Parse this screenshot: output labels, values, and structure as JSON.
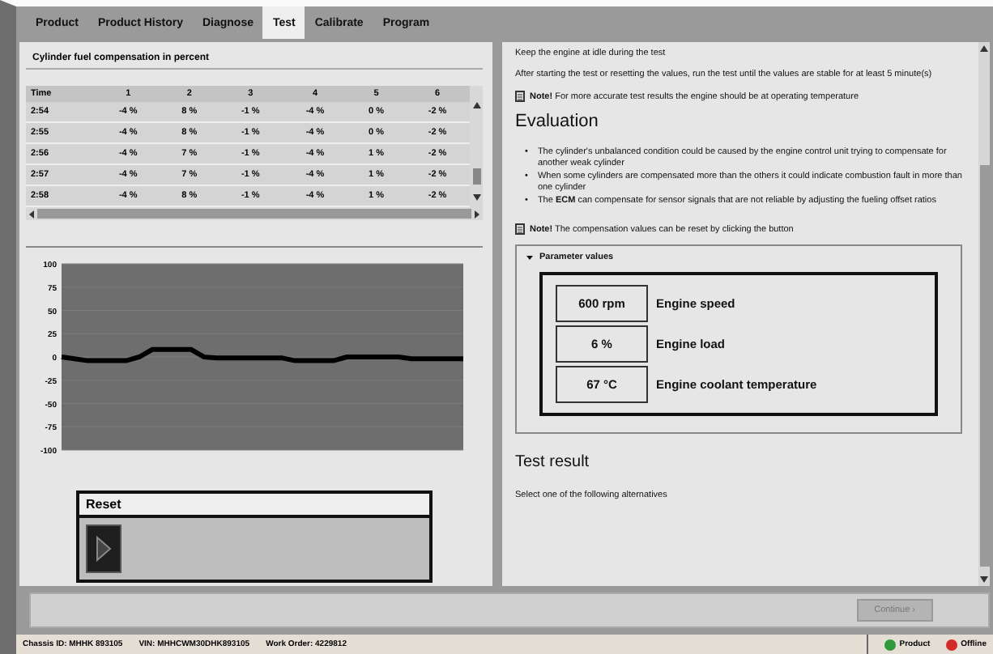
{
  "tabs": [
    {
      "label": "Product",
      "selected": false
    },
    {
      "label": "Product History",
      "selected": false
    },
    {
      "label": "Diagnose",
      "selected": false
    },
    {
      "label": "Test",
      "selected": true
    },
    {
      "label": "Calibrate",
      "selected": false
    },
    {
      "label": "Program",
      "selected": false
    }
  ],
  "left_panel": {
    "title": "Cylinder fuel compensation in percent",
    "table": {
      "columns": [
        "Time",
        "1",
        "2",
        "3",
        "4",
        "5",
        "6"
      ],
      "rows": [
        [
          "2:54",
          "-4 %",
          "8 %",
          "-1 %",
          "-4 %",
          "0 %",
          "-2 %"
        ],
        [
          "2:55",
          "-4 %",
          "8 %",
          "-1 %",
          "-4 %",
          "0 %",
          "-2 %"
        ],
        [
          "2:56",
          "-4 %",
          "7 %",
          "-1 %",
          "-4 %",
          "1 %",
          "-2 %"
        ],
        [
          "2:57",
          "-4 %",
          "7 %",
          "-1 %",
          "-4 %",
          "1 %",
          "-2 %"
        ],
        [
          "2:58",
          "-4 %",
          "8 %",
          "-1 %",
          "-4 %",
          "1 %",
          "-2 %"
        ]
      ]
    },
    "chart_data": {
      "type": "line",
      "grid": true,
      "ylim": [
        -100,
        100
      ],
      "yticks": [
        100,
        75,
        50,
        25,
        0,
        -25,
        -50,
        -75,
        -100
      ],
      "series": [
        {
          "color": "#000000",
          "values": [
            0,
            -2,
            -4,
            -4,
            -4,
            -4,
            0,
            8,
            8,
            8,
            8,
            0,
            -1,
            -1,
            -1,
            -1,
            -1,
            -1,
            -4,
            -4,
            -4,
            -4,
            0,
            0,
            0,
            0,
            0,
            -2,
            -2,
            -2,
            -2,
            -2
          ]
        }
      ]
    },
    "reset": {
      "title": "Reset"
    }
  },
  "right_panel": {
    "intro": [
      "Keep the engine at idle during the test",
      "After starting the test or resetting the values, run the test until the values are stable for at least 5 minute(s)"
    ],
    "note_1": "**Note!** For more accurate test results the engine should be at operating temperature",
    "heading": "Evaluation",
    "bullets": [
      {
        "marker": "•",
        "text": "The cylinder's unbalanced condition could be caused by the engine control unit trying to compensate for another weak cylinder"
      },
      {
        "marker": "•",
        "text": "When some cylinders are compensated more than the others it could indicate combustion fault in more than one cylinder"
      },
      {
        "marker": "•",
        "text": "The **ECM** can compensate for sensor signals that are not reliable by adjusting the fueling offset ratios"
      }
    ],
    "note_2": "**Note!** The compensation values can be reset by clicking the button",
    "parameters": {
      "title": "Parameter values",
      "expanded": true,
      "items": [
        {
          "value": "600 rpm",
          "label": "Engine speed"
        },
        {
          "value": "6 %",
          "label": "Engine load"
        },
        {
          "value": "67 °C",
          "label": "Engine coolant temperature"
        }
      ]
    },
    "result_heading": "Test result",
    "result_text": "Select one of the following alternatives"
  },
  "continue_button": {
    "label": "Continue ›",
    "disabled": true
  },
  "status_bar": {
    "items": [
      "Chassis ID: MHHK 893105",
      "VIN: MHHCWM30DHK893105",
      "Work Order: 4229812"
    ],
    "indicators": [
      {
        "label": "Product",
        "color": "#2e9a3a"
      },
      {
        "label": "Offline",
        "color": "#d42a2a"
      }
    ]
  }
}
